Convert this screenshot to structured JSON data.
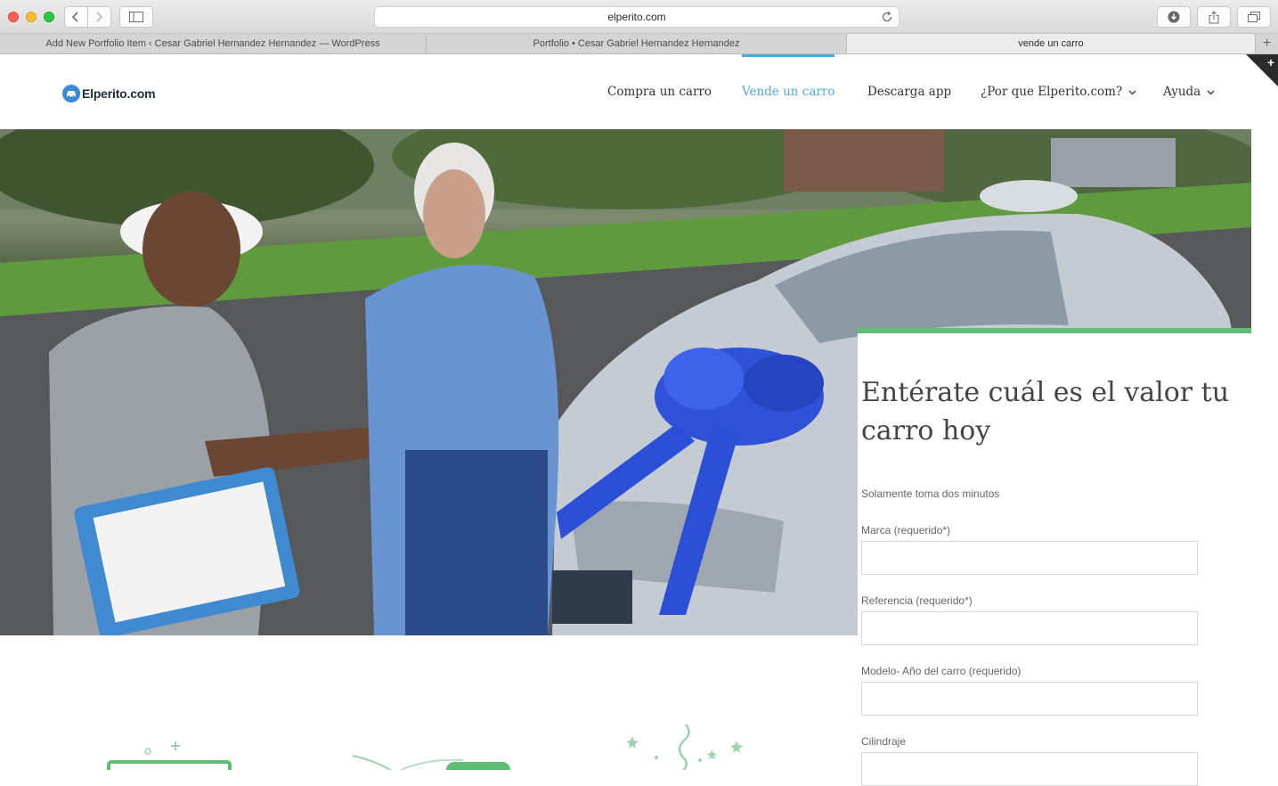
{
  "browser": {
    "url": "elperito.com",
    "tabs": [
      {
        "label": "Add New Portfolio Item ‹ Cesar Gabriel Hernandez Hernandez — WordPress",
        "active": false
      },
      {
        "label": "Portfolio • Cesar Gabriel Hernandez Hernandez",
        "active": true
      },
      {
        "label": "vende un carro",
        "active": false
      }
    ]
  },
  "site": {
    "logo_text": "Elperito.com",
    "nav": [
      {
        "label": "Compra un carro",
        "active": false,
        "dropdown": false
      },
      {
        "label": "Vende un carro",
        "active": true,
        "dropdown": false
      },
      {
        "label": "Descarga app",
        "active": false,
        "dropdown": false
      },
      {
        "label": "¿Por que Elperito.com?",
        "active": false,
        "dropdown": true
      },
      {
        "label": "Ayuda",
        "active": false,
        "dropdown": true
      }
    ],
    "accent_color": "#4fa8dc",
    "form_accent_color": "#5fbd75"
  },
  "form": {
    "title": "Entérate cuál es el valor tu carro hoy",
    "subtitle": "Solamente toma dos minutos",
    "fields": [
      {
        "label": "Marca (requerido*)",
        "value": ""
      },
      {
        "label": "Referencia (requerido*)",
        "value": ""
      },
      {
        "label": "Modelo- Año del carro (requerido)",
        "value": ""
      },
      {
        "label": "Cilindraje",
        "value": ""
      }
    ]
  }
}
